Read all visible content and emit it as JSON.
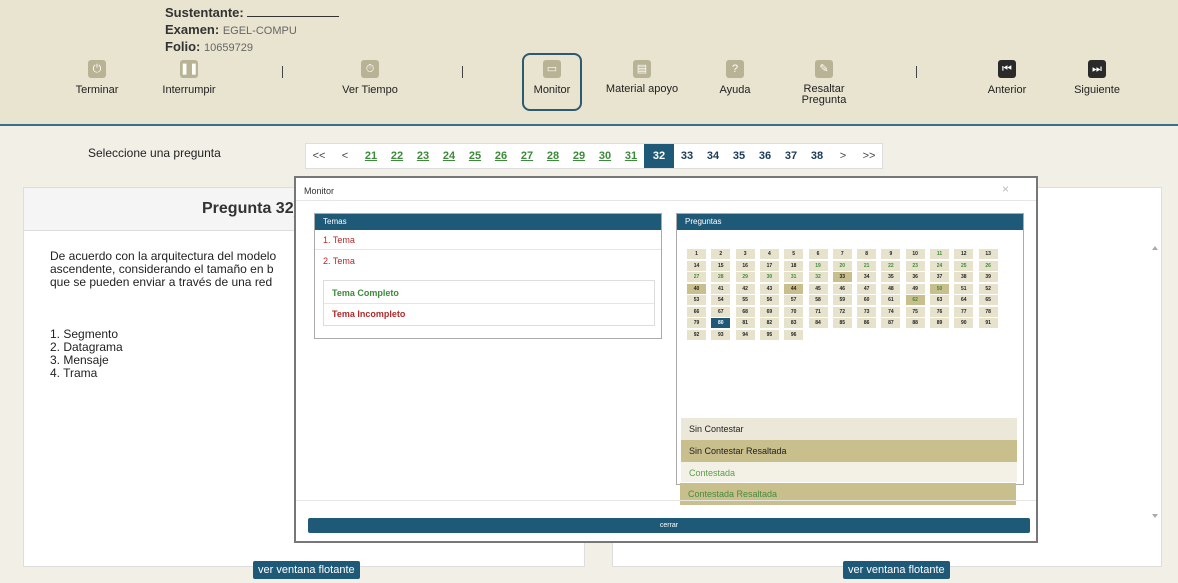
{
  "header": {
    "sustentante_label": "Sustentante:",
    "examen_label": "Examen:",
    "examen_value": "EGEL-COMPU",
    "folio_label": "Folio:",
    "folio_value": "10659729",
    "buttons": {
      "terminar": "Terminar",
      "interrumpir": "Interrumpir",
      "ver_tiempo": "Ver Tiempo",
      "monitor": "Monitor",
      "material": "Material apoyo",
      "ayuda": "Ayuda",
      "resaltar": "Resaltar Pregunta",
      "anterior": "Anterior",
      "siguiente": "Siguiente"
    },
    "icon_glyphs": {
      "ayuda": "?"
    }
  },
  "pagination": {
    "label": "Seleccione una pregunta",
    "first": "<<",
    "prev": "<",
    "next": ">",
    "last": ">>",
    "answered": [
      "21",
      "22",
      "23",
      "24",
      "25",
      "26",
      "27",
      "28",
      "29",
      "30",
      "31"
    ],
    "current": "32",
    "pending": [
      "33",
      "34",
      "35",
      "36",
      "37",
      "38"
    ]
  },
  "question": {
    "title": "Pregunta 32)",
    "text_lines": [
      "De acuerdo con la arquitectura del modelo",
      "ascendente, considerando el tamaño en b",
      "que se pueden enviar a través de una red"
    ],
    "options": [
      "1. Segmento",
      "2. Datagrama",
      "3. Mensaje",
      "4. Trama"
    ]
  },
  "float_button": "ver ventana flotante",
  "modal": {
    "title": "Monitor",
    "close": "×",
    "temas": {
      "header": "Temas",
      "items": [
        "1. Tema",
        "2. Tema"
      ],
      "legend_complete": "Tema Completo",
      "legend_incomplete": "Tema Incompleto"
    },
    "preguntas": {
      "header": "Preguntas",
      "cells": [
        {
          "n": "1",
          "s": "p"
        },
        {
          "n": "2",
          "s": "p"
        },
        {
          "n": "3",
          "s": "p"
        },
        {
          "n": "4",
          "s": "p"
        },
        {
          "n": "5",
          "s": "p"
        },
        {
          "n": "6",
          "s": "p"
        },
        {
          "n": "7",
          "s": "p"
        },
        {
          "n": "8",
          "s": "p"
        },
        {
          "n": "9",
          "s": "p"
        },
        {
          "n": "10",
          "s": "p"
        },
        {
          "n": "11",
          "s": "c"
        },
        {
          "n": "12",
          "s": "p"
        },
        {
          "n": "13",
          "s": "p"
        },
        {
          "n": "14",
          "s": "p"
        },
        {
          "n": "15",
          "s": "p"
        },
        {
          "n": "16",
          "s": "p"
        },
        {
          "n": "17",
          "s": "p"
        },
        {
          "n": "18",
          "s": "p"
        },
        {
          "n": "19",
          "s": "c"
        },
        {
          "n": "20",
          "s": "c"
        },
        {
          "n": "21",
          "s": "c"
        },
        {
          "n": "22",
          "s": "c"
        },
        {
          "n": "23",
          "s": "c"
        },
        {
          "n": "24",
          "s": "c"
        },
        {
          "n": "25",
          "s": "c"
        },
        {
          "n": "26",
          "s": "c"
        },
        {
          "n": "27",
          "s": "c"
        },
        {
          "n": "28",
          "s": "c"
        },
        {
          "n": "29",
          "s": "c"
        },
        {
          "n": "30",
          "s": "c"
        },
        {
          "n": "31",
          "s": "c"
        },
        {
          "n": "32",
          "s": "c"
        },
        {
          "n": "33",
          "s": "h"
        },
        {
          "n": "34",
          "s": "p"
        },
        {
          "n": "35",
          "s": "p"
        },
        {
          "n": "36",
          "s": "p"
        },
        {
          "n": "37",
          "s": "p"
        },
        {
          "n": "38",
          "s": "p"
        },
        {
          "n": "39",
          "s": "p"
        },
        {
          "n": "40",
          "s": "h"
        },
        {
          "n": "41",
          "s": "p"
        },
        {
          "n": "42",
          "s": "p"
        },
        {
          "n": "43",
          "s": "p"
        },
        {
          "n": "44",
          "s": "h"
        },
        {
          "n": "45",
          "s": "p"
        },
        {
          "n": "46",
          "s": "p"
        },
        {
          "n": "47",
          "s": "p"
        },
        {
          "n": "48",
          "s": "p"
        },
        {
          "n": "49",
          "s": "p"
        },
        {
          "n": "50",
          "s": "ch"
        },
        {
          "n": "51",
          "s": "p"
        },
        {
          "n": "52",
          "s": "p"
        },
        {
          "n": "53",
          "s": "p"
        },
        {
          "n": "54",
          "s": "p"
        },
        {
          "n": "55",
          "s": "p"
        },
        {
          "n": "56",
          "s": "p"
        },
        {
          "n": "57",
          "s": "p"
        },
        {
          "n": "58",
          "s": "p"
        },
        {
          "n": "59",
          "s": "p"
        },
        {
          "n": "60",
          "s": "p"
        },
        {
          "n": "61",
          "s": "p"
        },
        {
          "n": "62",
          "s": "ch"
        },
        {
          "n": "63",
          "s": "p"
        },
        {
          "n": "64",
          "s": "p"
        },
        {
          "n": "65",
          "s": "p"
        },
        {
          "n": "66",
          "s": "p"
        },
        {
          "n": "67",
          "s": "p"
        },
        {
          "n": "68",
          "s": "p"
        },
        {
          "n": "69",
          "s": "p"
        },
        {
          "n": "70",
          "s": "p"
        },
        {
          "n": "71",
          "s": "p"
        },
        {
          "n": "72",
          "s": "p"
        },
        {
          "n": "73",
          "s": "p"
        },
        {
          "n": "74",
          "s": "p"
        },
        {
          "n": "75",
          "s": "p"
        },
        {
          "n": "76",
          "s": "p"
        },
        {
          "n": "77",
          "s": "p"
        },
        {
          "n": "78",
          "s": "p"
        },
        {
          "n": "79",
          "s": "p"
        },
        {
          "n": "80",
          "s": "cur"
        },
        {
          "n": "81",
          "s": "p"
        },
        {
          "n": "82",
          "s": "p"
        },
        {
          "n": "83",
          "s": "p"
        },
        {
          "n": "84",
          "s": "p"
        },
        {
          "n": "85",
          "s": "p"
        },
        {
          "n": "86",
          "s": "p"
        },
        {
          "n": "87",
          "s": "p"
        },
        {
          "n": "88",
          "s": "p"
        },
        {
          "n": "89",
          "s": "p"
        },
        {
          "n": "90",
          "s": "p"
        },
        {
          "n": "91",
          "s": "p"
        },
        {
          "n": "92",
          "s": "p"
        },
        {
          "n": "93",
          "s": "p"
        },
        {
          "n": "94",
          "s": "p"
        },
        {
          "n": "95",
          "s": "p"
        },
        {
          "n": "96",
          "s": "p"
        }
      ],
      "legend": [
        "Sin Contestar",
        "Sin Contestar Resaltada",
        "Contestada",
        "Contestada Resaltada"
      ]
    },
    "close_button": "cerrar"
  },
  "colors": {
    "primary": "#1e5a78",
    "answered_text": "#3d8a3a",
    "incomplete_text": "#b02a2a",
    "highlight": "#c9bf8c",
    "unanswered": "#e6e2cc"
  }
}
